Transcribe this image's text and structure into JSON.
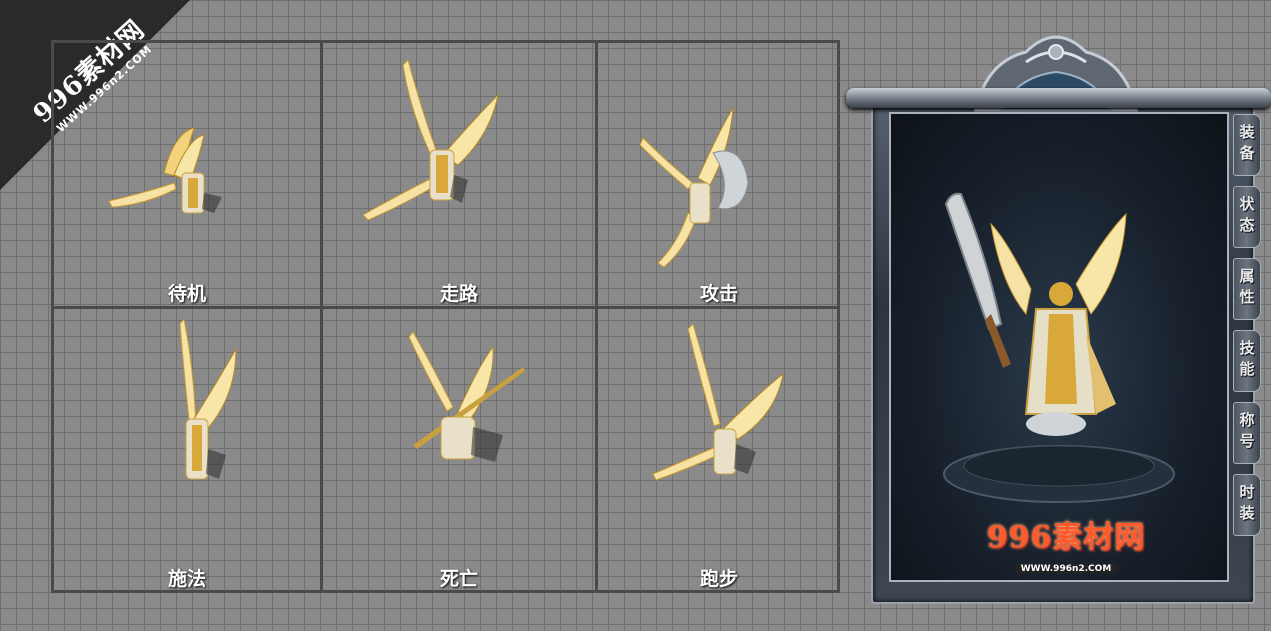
{
  "watermark": {
    "brand": "996素材网",
    "url": "WWW.996n2.COM"
  },
  "animations": [
    {
      "label": "待机"
    },
    {
      "label": "走路"
    },
    {
      "label": "攻击"
    },
    {
      "label": "施法"
    },
    {
      "label": "死亡"
    },
    {
      "label": "跑步"
    }
  ],
  "panel": {
    "tabs": [
      {
        "label": "装备"
      },
      {
        "label": "状态"
      },
      {
        "label": "属性"
      },
      {
        "label": "技能"
      },
      {
        "label": "称号"
      },
      {
        "label": "时装"
      }
    ],
    "logo": {
      "brand": "996素材网",
      "url": "WWW.996n2.COM"
    }
  },
  "colors": {
    "background": "#8a8a8a",
    "grid_line": "#4a4a4a",
    "wing_gold": "#f2d27a",
    "logo_red": "#ff5a2a"
  }
}
